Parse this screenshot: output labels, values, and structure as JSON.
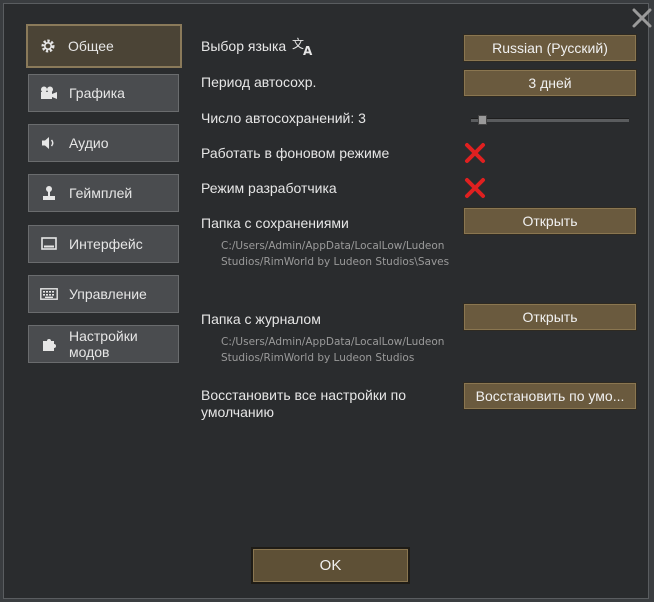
{
  "nav": {
    "items": [
      {
        "label": "Общее",
        "icon": "gear-icon"
      },
      {
        "label": "Графика",
        "icon": "camera-icon"
      },
      {
        "label": "Аудио",
        "icon": "speaker-icon"
      },
      {
        "label": "Геймплей",
        "icon": "joystick-icon"
      },
      {
        "label": "Интерфейс",
        "icon": "monitor-icon"
      },
      {
        "label": "Управление",
        "icon": "keyboard-icon"
      },
      {
        "label": "Настройки модов",
        "icon": "puzzle-icon"
      }
    ]
  },
  "settings": {
    "language_label": "Выбор языка",
    "language_value": "Russian (Русский)",
    "autosave_period_label": "Период автосохр.",
    "autosave_period_value": "3 дней",
    "autosave_count_label": "Число автосохранений: 3",
    "autosave_count_value": 3,
    "background_label": "Работать в фоновом режиме",
    "background_enabled": false,
    "devmode_label": "Режим разработчика",
    "devmode_enabled": false,
    "save_folder_label": "Папка с сохранениями",
    "save_folder_button": "Открыть",
    "save_folder_path_line1": "C:/Users/Admin/AppData/LocalLow/Ludeon",
    "save_folder_path_line2": "Studios/RimWorld by Ludeon Studios\\Saves",
    "log_folder_label": "Папка с журналом",
    "log_folder_button": "Открыть",
    "log_folder_path_line1": "C:/Users/Admin/AppData/LocalLow/Ludeon",
    "log_folder_path_line2": "Studios/RimWorld by Ludeon Studios",
    "reset_label_line1": "Восстановить все настройки по",
    "reset_label_line2": "умолчанию",
    "reset_button": "Восстановить по умо..."
  },
  "footer": {
    "ok_label": "OK"
  },
  "colors": {
    "accent": "#6a5a3e",
    "disabled_x": "#e02020",
    "background": "#2a2c2e"
  }
}
